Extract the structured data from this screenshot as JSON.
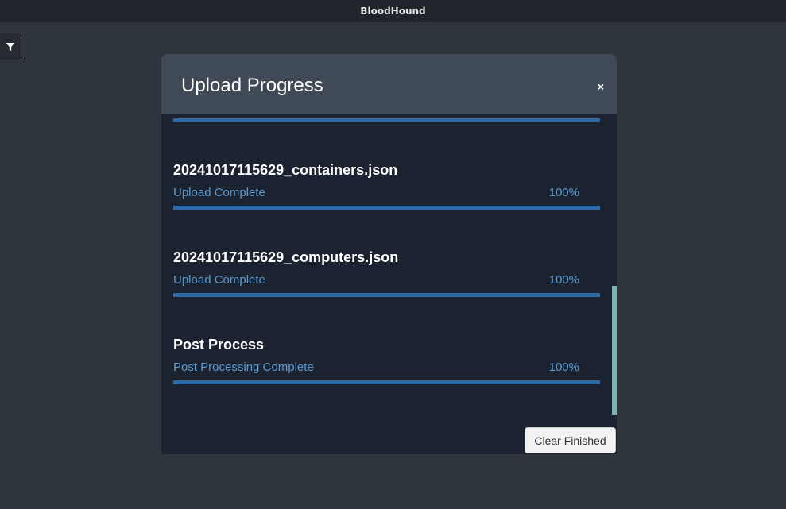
{
  "app": {
    "title": "BloodHound"
  },
  "modal": {
    "title": "Upload Progress",
    "close_label": "×",
    "items": [
      {
        "name": "",
        "status": "",
        "percent_label": "",
        "progress": 1.0
      },
      {
        "name": "20241017115629_containers.json",
        "status": "Upload Complete",
        "percent_label": "100%",
        "progress": 1.0
      },
      {
        "name": "20241017115629_computers.json",
        "status": "Upload Complete",
        "percent_label": "100%",
        "progress": 1.0
      },
      {
        "name": "Post Process",
        "status": "Post Processing Complete",
        "percent_label": "100%",
        "progress": 1.0
      }
    ],
    "clear_button_label": "Clear Finished"
  },
  "colors": {
    "progress_fill": "#2f6aa8",
    "status_text": "#5b9ad1",
    "modal_body": "#1b2330",
    "modal_header": "#404956"
  },
  "icons": {
    "filter": "filter-icon"
  }
}
